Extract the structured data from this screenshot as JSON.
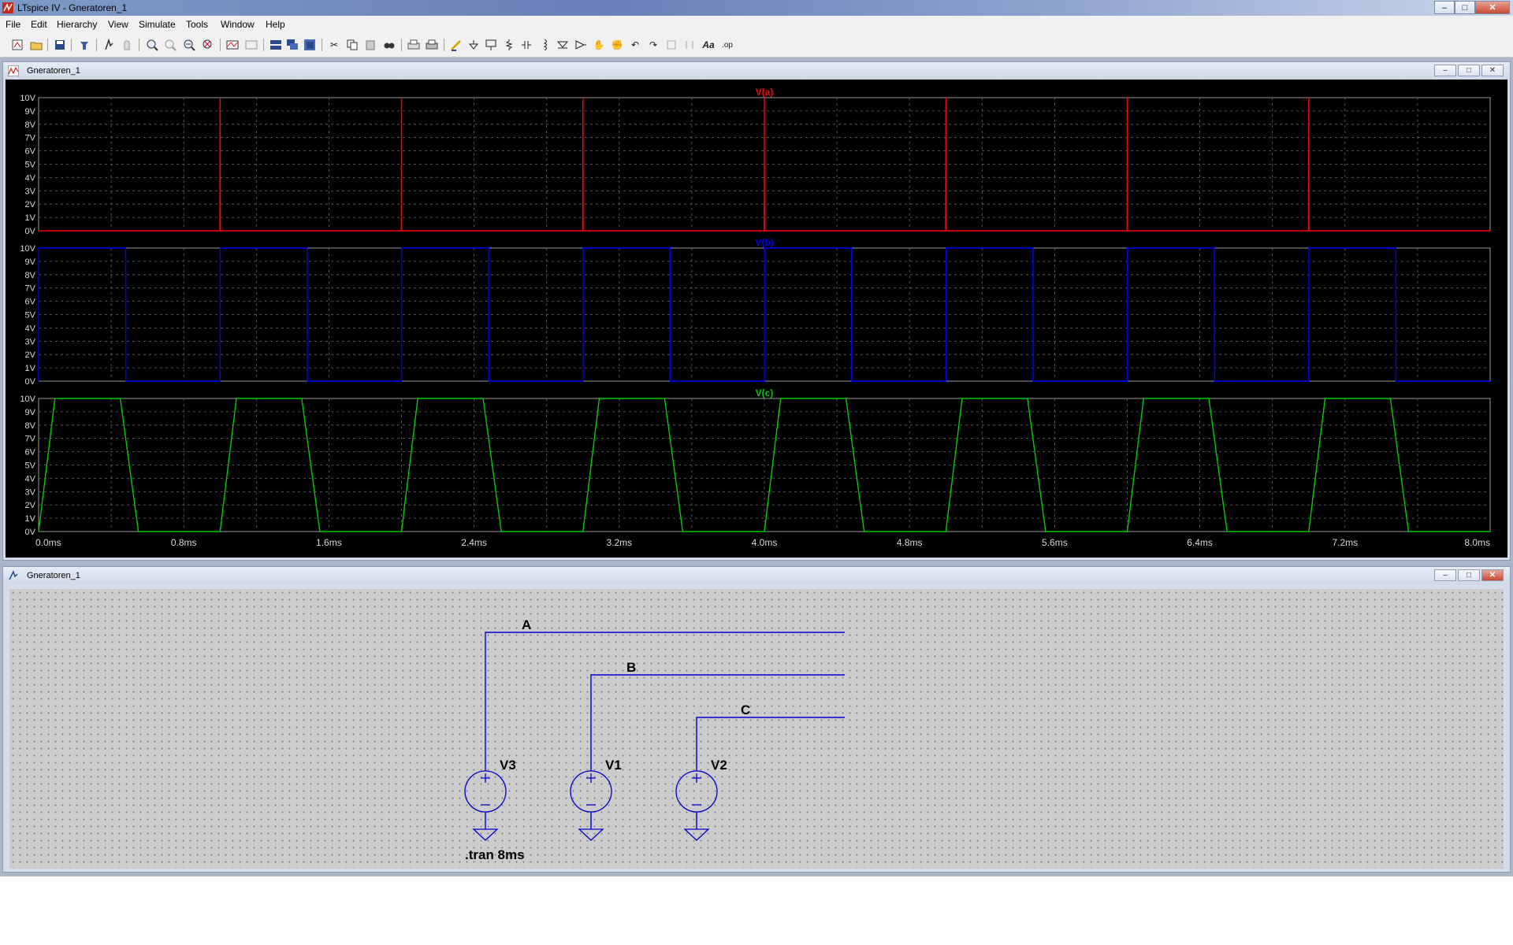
{
  "app": {
    "title": "LTspice IV - Gneratoren_1",
    "window_buttons": [
      "–",
      "□",
      "✕"
    ]
  },
  "menu": {
    "items": [
      "File",
      "Edit",
      "Hierarchy",
      "View",
      "Simulate",
      "Tools",
      "Window",
      "Help"
    ]
  },
  "toolbar": {
    "icons": [
      "new-schematic-icon",
      "open-icon",
      "save-icon",
      "control-panel-icon",
      "run-icon",
      "halt-icon",
      "zoom-in-icon",
      "zoom-area-icon",
      "zoom-out-icon",
      "zoom-fit-icon",
      "autorange-icon",
      "grid-icon",
      "tile-horizontal-icon",
      "cascade-icon",
      "tile-vertical-icon",
      "cut-icon",
      "copy-icon",
      "paste-icon",
      "find-icon",
      "print-preview-icon",
      "print-icon",
      "wire-icon",
      "ground-icon",
      "label-net-icon",
      "resistor-icon",
      "capacitor-icon",
      "inductor-icon",
      "diode-icon",
      "component-icon",
      "move-icon",
      "drag-icon",
      "undo-icon",
      "redo-icon",
      "rotate-icon",
      "mirror-icon",
      "text-icon",
      "spice-directive-icon"
    ],
    "text_icons": {
      "text": "Aa",
      "directive": ".op"
    }
  },
  "plot_window": {
    "title": "Gneratoren_1",
    "buttons": [
      "–",
      "□",
      "✕"
    ]
  },
  "schematic_window": {
    "title": "Gneratoren_1",
    "buttons": [
      "–",
      "□",
      "✕"
    ],
    "nets": [
      "A",
      "B",
      "C"
    ],
    "sources": [
      "V3",
      "V1",
      "V2"
    ],
    "directive": ".tran 8ms"
  },
  "chart_data": [
    {
      "type": "line",
      "title": "V(a)",
      "color": "#ff0000",
      "xlim": [
        0,
        8
      ],
      "ylim": [
        0,
        10
      ],
      "yticks": [
        "0V",
        "1V",
        "2V",
        "3V",
        "4V",
        "5V",
        "6V",
        "7V",
        "8V",
        "9V",
        "10V"
      ],
      "series": [
        {
          "name": "V(a)",
          "x": [
            0,
            0.999,
            1.0,
            1.001,
            1.999,
            2.0,
            2.001,
            2.999,
            3.0,
            3.001,
            3.999,
            4.0,
            4.001,
            4.999,
            5.0,
            5.001,
            5.999,
            6.0,
            6.001,
            6.999,
            7.0,
            7.001,
            8.0
          ],
          "y": [
            0,
            0,
            10,
            0,
            0,
            10,
            0,
            0,
            10,
            0,
            0,
            10,
            0,
            0,
            10,
            0,
            0,
            10,
            0,
            0,
            10,
            0,
            0
          ]
        }
      ]
    },
    {
      "type": "line",
      "title": "V(b)",
      "color": "#0000ff",
      "xlim": [
        0,
        8
      ],
      "ylim": [
        0,
        10
      ],
      "yticks": [
        "0V",
        "1V",
        "2V",
        "3V",
        "4V",
        "5V",
        "6V",
        "7V",
        "8V",
        "9V",
        "10V"
      ],
      "series": [
        {
          "name": "V(b)",
          "x": [
            0,
            0.001,
            0.48,
            0.481,
            1.0,
            1.001,
            1.48,
            1.481,
            2.0,
            2.001,
            2.48,
            2.481,
            3.0,
            3.001,
            3.48,
            3.481,
            4.0,
            4.001,
            4.48,
            4.481,
            5.0,
            5.001,
            5.48,
            5.481,
            6.0,
            6.001,
            6.48,
            6.481,
            7.0,
            7.001,
            7.48,
            7.481,
            8.0
          ],
          "y": [
            0,
            10,
            10,
            0,
            0,
            10,
            10,
            0,
            0,
            10,
            10,
            0,
            0,
            10,
            10,
            0,
            0,
            10,
            10,
            0,
            0,
            10,
            10,
            0,
            0,
            10,
            10,
            0,
            0,
            10,
            10,
            0,
            0
          ]
        }
      ]
    },
    {
      "type": "line",
      "title": "V(c)",
      "color": "#00cc00",
      "xlim": [
        0,
        8
      ],
      "ylim": [
        0,
        10
      ],
      "yticks": [
        "0V",
        "1V",
        "2V",
        "3V",
        "4V",
        "5V",
        "6V",
        "7V",
        "8V",
        "9V",
        "10V"
      ],
      "xticks": [
        "0.0ms",
        "0.8ms",
        "1.6ms",
        "2.4ms",
        "3.2ms",
        "4.0ms",
        "4.8ms",
        "5.6ms",
        "6.4ms",
        "7.2ms",
        "8.0ms"
      ],
      "series": [
        {
          "name": "V(c)",
          "x": [
            0,
            0.09,
            0.45,
            0.55,
            1.0,
            1.09,
            1.45,
            1.55,
            2.0,
            2.09,
            2.45,
            2.55,
            3.0,
            3.09,
            3.45,
            3.55,
            4.0,
            4.09,
            4.45,
            4.55,
            5.0,
            5.09,
            5.45,
            5.55,
            6.0,
            6.09,
            6.45,
            6.55,
            7.0,
            7.09,
            7.45,
            7.55,
            8.0
          ],
          "y": [
            0,
            10,
            10,
            0,
            0,
            10,
            10,
            0,
            0,
            10,
            10,
            0,
            0,
            10,
            10,
            0,
            0,
            10,
            10,
            0,
            0,
            10,
            10,
            0,
            0,
            10,
            10,
            0,
            0,
            10,
            10,
            0,
            0
          ]
        }
      ]
    }
  ]
}
